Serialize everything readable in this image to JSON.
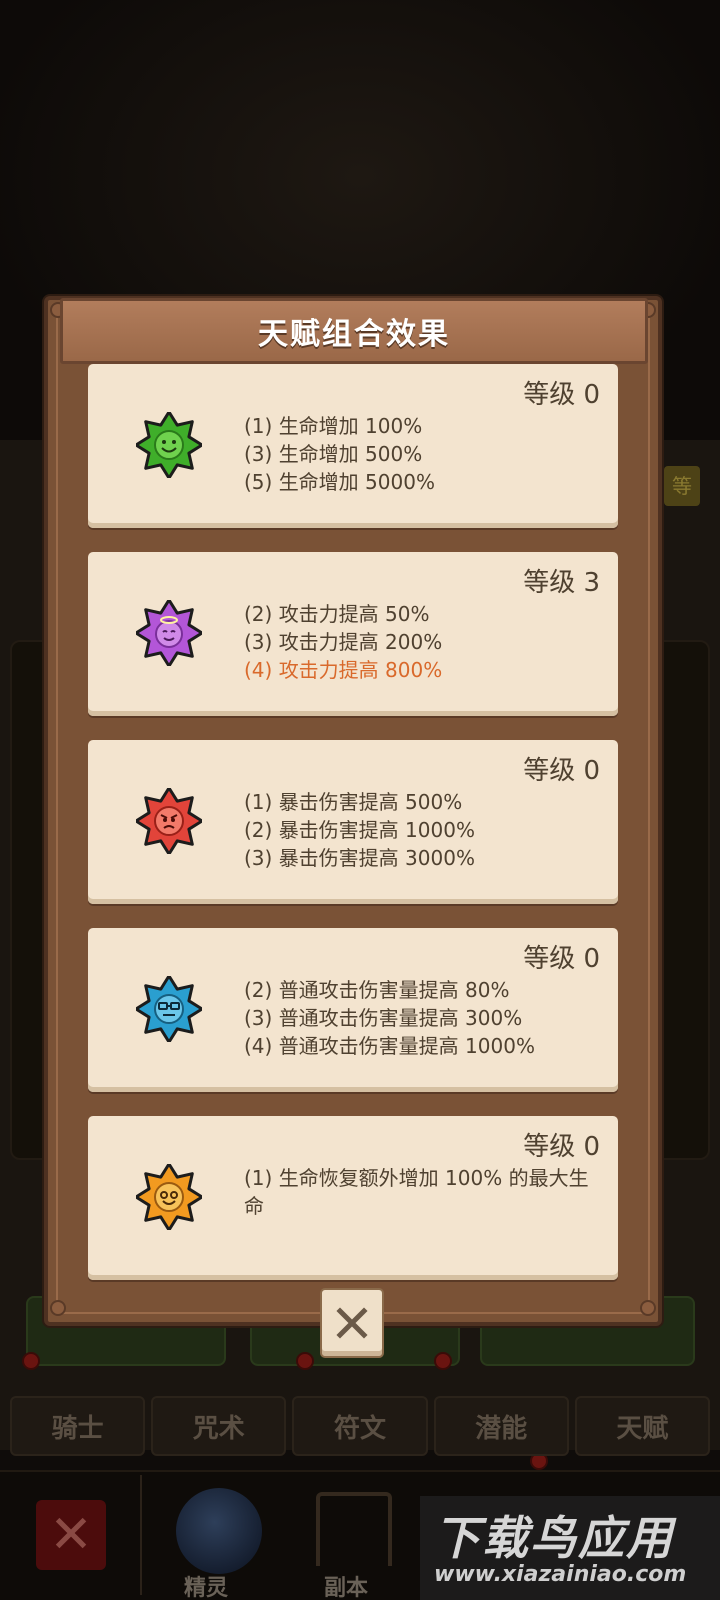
{
  "dialog": {
    "title": "天赋组合效果",
    "cards": [
      {
        "level": "等级 0",
        "icon": "green-smile-star-icon",
        "color": "#3fae2a",
        "effects": [
          {
            "text": "(1) 生命增加 100%",
            "active": false
          },
          {
            "text": "(3) 生命增加 500%",
            "active": false
          },
          {
            "text": "(5) 生命增加 5000%",
            "active": false
          }
        ]
      },
      {
        "level": "等级 3",
        "icon": "purple-angel-star-icon",
        "color": "#b356d8",
        "effects": [
          {
            "text": "(2) 攻击力提高 50%",
            "active": false
          },
          {
            "text": "(3) 攻击力提高 200%",
            "active": false
          },
          {
            "text": "(4) 攻击力提高 800%",
            "active": true
          }
        ]
      },
      {
        "level": "等级 0",
        "icon": "red-angry-star-icon",
        "color": "#e2443a",
        "effects": [
          {
            "text": "(1) 暴击伤害提高 500%",
            "active": false
          },
          {
            "text": "(2) 暴击伤害提高 1000%",
            "active": false
          },
          {
            "text": "(3) 暴击伤害提高 3000%",
            "active": false
          }
        ]
      },
      {
        "level": "等级 0",
        "icon": "blue-glasses-star-icon",
        "color": "#2a9fd0",
        "effects": [
          {
            "text": "(2) 普通攻击伤害量提高 80%",
            "active": false
          },
          {
            "text": "(3) 普通攻击伤害量提高 300%",
            "active": false
          },
          {
            "text": "(4) 普通攻击伤害量提高 1000%",
            "active": false
          }
        ]
      },
      {
        "level": "等级 0",
        "icon": "orange-happy-star-icon",
        "color": "#f29a20",
        "effects": [
          {
            "text": "(1) 生命恢复额外增加 100% 的最大生命",
            "active": false
          }
        ]
      }
    ],
    "close_icon": "close-x-icon"
  },
  "background": {
    "tabs": [
      "骑士",
      "咒术",
      "符文",
      "潜能",
      "天赋"
    ],
    "bottom_items": [
      "精灵",
      "副本"
    ],
    "side_badge": "等"
  },
  "watermark": {
    "title": "下载鸟应用",
    "url": "www.xiazainiao.com"
  },
  "colors": {
    "dialog_wood": "#7a5236",
    "card_bg": "#f3e4cf",
    "active_effect": "#d9692b",
    "text_dark": "#4f4130"
  }
}
